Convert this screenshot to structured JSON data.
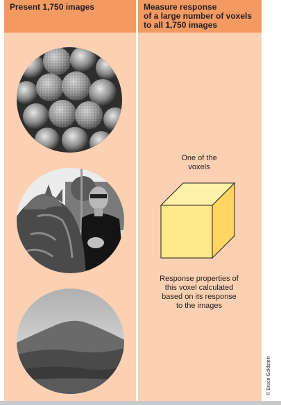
{
  "left_panel": {
    "header": "Present 1,750 images",
    "images": [
      "cactus-photo",
      "carousel-man-photo",
      "hills-landscape-photo"
    ]
  },
  "right_panel": {
    "header_lines": [
      "Measure response",
      "of a large number of voxels",
      "to all 1,750 images"
    ],
    "voxel_label_lines": [
      "One of the",
      "voxels"
    ],
    "response_lines": [
      "Response properties of",
      "this voxel calculated",
      "based on its response",
      "to the images"
    ]
  },
  "credit": "© Bruce Goldstein",
  "colors": {
    "panel_bg": "#fcd0b2",
    "header_bg": "#f39a63",
    "voxel_front": "#fde98a",
    "voxel_side": "#fcd562",
    "voxel_top": "#fff1a8"
  }
}
